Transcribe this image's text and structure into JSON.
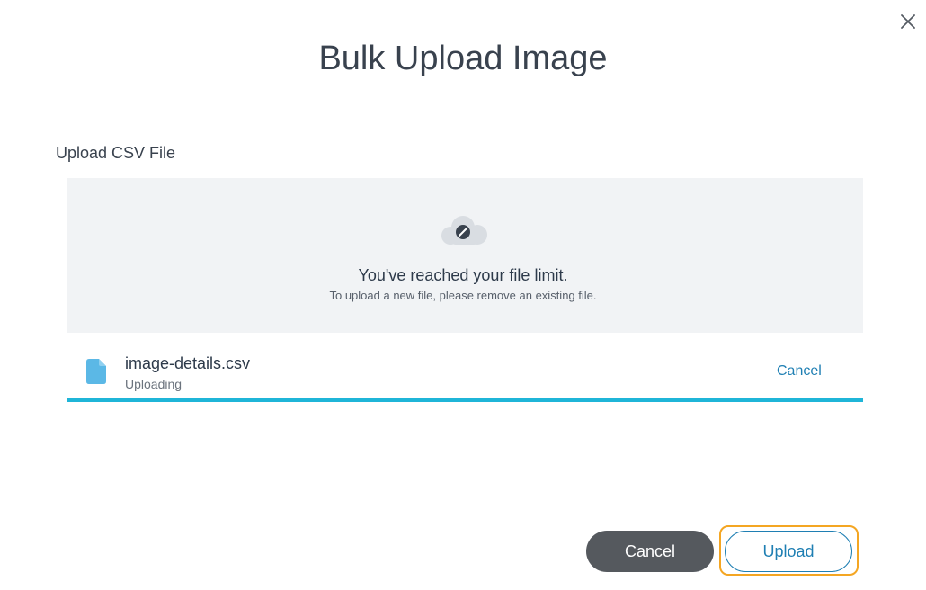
{
  "dialog": {
    "title": "Bulk Upload Image",
    "close_icon": "close-icon"
  },
  "upload": {
    "section_label": "Upload CSV File",
    "dropzone": {
      "icon": "cloud-disabled-icon",
      "limit_title": "You've reached your file limit.",
      "limit_subtitle": "To upload a new file, please remove an existing file."
    },
    "file": {
      "icon": "file-icon",
      "name": "image-details.csv",
      "status": "Uploading",
      "cancel_label": "Cancel",
      "progress_percent": 100
    }
  },
  "footer": {
    "cancel_label": "Cancel",
    "upload_label": "Upload"
  },
  "colors": {
    "accent": "#1f7fb3",
    "progress": "#1fb5d8",
    "focus_ring": "#f4a623",
    "cancel_bg": "#55595e",
    "dropzone_bg": "#f1f3f5"
  }
}
